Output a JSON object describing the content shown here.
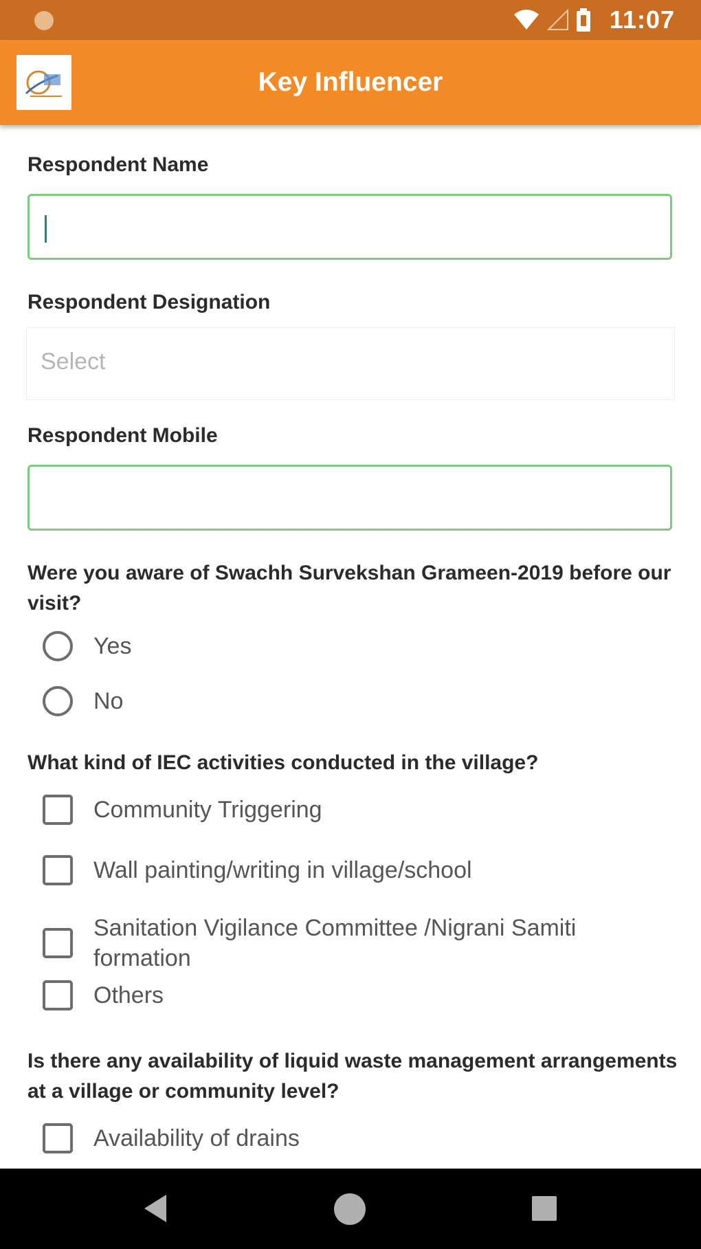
{
  "status_bar": {
    "time": "11:07",
    "icons": [
      "notification-dot-icon",
      "wifi-icon",
      "signal-icon",
      "battery-icon"
    ]
  },
  "app_bar": {
    "title": "Key Influencer",
    "logo": "app-logo"
  },
  "form": {
    "respondent_name": {
      "label": "Respondent Name",
      "value": ""
    },
    "respondent_designation": {
      "label": "Respondent Designation",
      "placeholder": "Select"
    },
    "respondent_mobile": {
      "label": "Respondent Mobile",
      "value": ""
    },
    "awareness_question": {
      "label": "Were you aware of Swachh Survekshan Grameen-2019 before our visit?",
      "options": [
        "Yes",
        "No"
      ]
    },
    "iec_question": {
      "label": "What kind of IEC activities conducted in the village?",
      "options": [
        "Community Triggering",
        "Wall painting/writing in village/school",
        "Sanitation Vigilance Committee /Nigrani Samiti formation",
        "Others"
      ]
    },
    "liquid_waste_question": {
      "label": "Is there any availability of liquid waste management arrangements at a village or community level?",
      "options": [
        "Availability of drains"
      ]
    }
  },
  "colors": {
    "status_bar": "#c96d22",
    "app_bar": "#f28a26",
    "input_border": "#7fca7f",
    "nav_bar": "#000000"
  }
}
